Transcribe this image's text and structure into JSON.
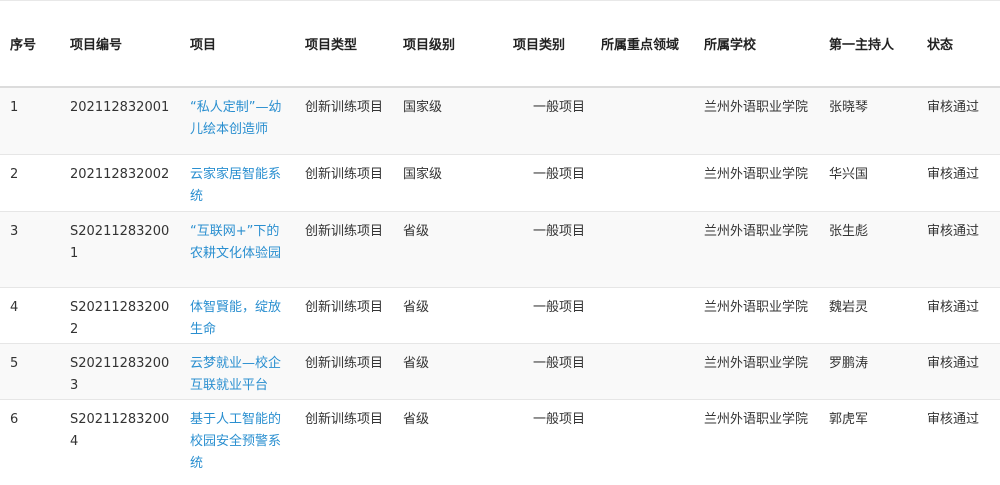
{
  "table": {
    "headers": [
      "序号",
      "项目编号",
      "项目",
      "项目类型",
      "项目级别",
      "项目类别",
      "所属重点领域",
      "所属学校",
      "第一主持人",
      "状态"
    ],
    "rows": [
      {
        "index": "1",
        "code": "202112832001",
        "project": "“私人定制”—幼儿绘本创造师",
        "type": "创新训练项目",
        "level": "国家级",
        "category": "一般项目",
        "field": "",
        "school": "兰州外语职业学院",
        "host": "张晓琴",
        "status": "审核通过"
      },
      {
        "index": "2",
        "code": "202112832002",
        "project": "云家家居智能系统",
        "type": "创新训练项目",
        "level": "国家级",
        "category": "一般项目",
        "field": "",
        "school": "兰州外语职业学院",
        "host": "华兴国",
        "status": "审核通过"
      },
      {
        "index": "3",
        "code": "S202112832001",
        "project": "“互联网+”下的农耕文化体验园",
        "type": "创新训练项目",
        "level": "省级",
        "category": "一般项目",
        "field": "",
        "school": "兰州外语职业学院",
        "host": "张生彪",
        "status": "审核通过"
      },
      {
        "index": "4",
        "code": "S202112832002",
        "project": "体智賢能，绽放生命",
        "type": "创新训练项目",
        "level": "省级",
        "category": "一般项目",
        "field": "",
        "school": "兰州外语职业学院",
        "host": "魏岩灵",
        "status": "审核通过"
      },
      {
        "index": "5",
        "code": "S202112832003",
        "project": "云梦就业—校企互联就业平台",
        "type": "创新训练项目",
        "level": "省级",
        "category": "一般项目",
        "field": "",
        "school": "兰州外语职业学院",
        "host": "罗鹏涛",
        "status": "审核通过"
      },
      {
        "index": "6",
        "code": "S202112832004",
        "project": "基于人工智能的校园安全预警系统",
        "type": "创新训练项目",
        "level": "省级",
        "category": "一般项目",
        "field": "",
        "school": "兰州外语职业学院",
        "host": "郭虎军",
        "status": "审核通过"
      }
    ]
  },
  "colors": {
    "link": "#2a8fd0",
    "text": "#333333",
    "stripe": "#f9f9f9",
    "border": "#e6e6e6"
  }
}
